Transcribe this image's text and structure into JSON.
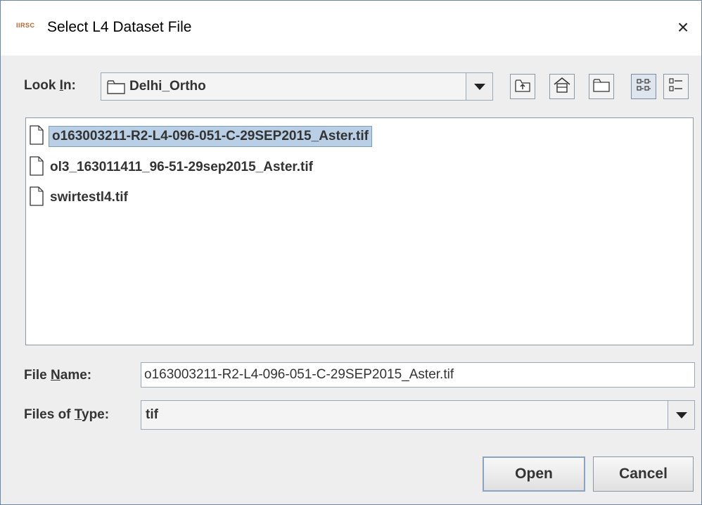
{
  "window": {
    "app_logo_text": "IIRSC",
    "title": "Select L4 Dataset File",
    "close_glyph": "×"
  },
  "look_in": {
    "label_before": "Look ",
    "label_mnemonic": "I",
    "label_after": "n:",
    "value": "Delhi_Ortho"
  },
  "toolbar": {
    "buttons": [
      "up-one-level-icon",
      "home-icon",
      "new-folder-icon",
      "list-view-icon",
      "details-view-icon"
    ],
    "active": "list-view-icon"
  },
  "files": [
    {
      "name": "o163003211-R2-L4-096-051-C-29SEP2015_Aster.tif",
      "selected": true
    },
    {
      "name": "ol3_163011411_96-51-29sep2015_Aster.tif",
      "selected": false
    },
    {
      "name": "swirtestl4.tif",
      "selected": false
    }
  ],
  "file_name": {
    "label_before": "File ",
    "label_mnemonic": "N",
    "label_after": "ame:",
    "value": "o163003211-R2-L4-096-051-C-29SEP2015_Aster.tif"
  },
  "file_type": {
    "label_before": "Files of ",
    "label_mnemonic": "T",
    "label_after": "ype:",
    "value": "tif"
  },
  "buttons": {
    "open": "Open",
    "cancel": "Cancel"
  },
  "colors": {
    "selection": "#b8cfe5",
    "border": "#8c97a6",
    "logo": "#c0612b"
  }
}
